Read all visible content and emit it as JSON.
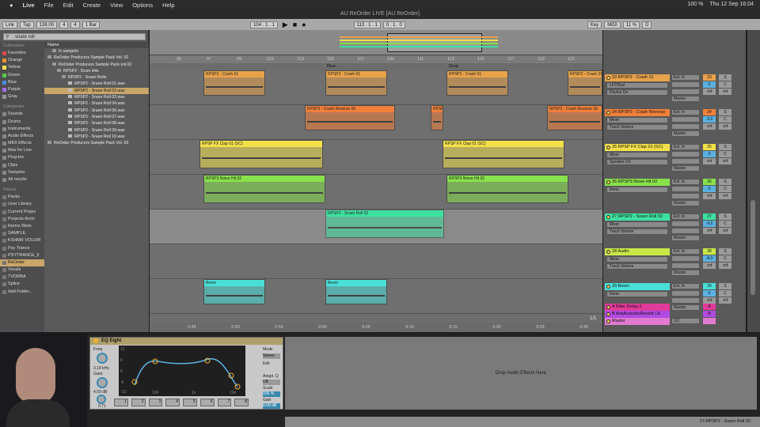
{
  "menubar": {
    "apple": "",
    "app": "Live",
    "items": [
      "File",
      "Edit",
      "Create",
      "View",
      "Options",
      "Help"
    ],
    "right": [
      "100 %",
      "Thu 12 Sep  16:04"
    ]
  },
  "window": {
    "title": "AU ReOrder LIVE  [AU ReOrder]"
  },
  "transport": {
    "link": "Link",
    "tap": "Tap",
    "tempo": "138.00",
    "sig_num": "4",
    "sig_den": "4",
    "quant": "1 Bar",
    "position": "104 .  1 .  1",
    "loop_start": "113 .  1 .  1",
    "loop_len": "0 .  1 .  0",
    "key": "Key",
    "midi": "MIDI",
    "cpu": "11 %",
    "d": "D"
  },
  "browser": {
    "search_value": "snare roll",
    "collections_header": "Collections",
    "collections": [
      {
        "label": "Favorites",
        "color": "#e24a4a"
      },
      {
        "label": "Orange",
        "color": "#f0903a"
      },
      {
        "label": "Yellow",
        "color": "#f2e04a"
      },
      {
        "label": "Green",
        "color": "#58c94a"
      },
      {
        "label": "Blue",
        "color": "#4a8ef0"
      },
      {
        "label": "Purple",
        "color": "#a46ef0"
      },
      {
        "label": "Gray",
        "color": "#999999"
      }
    ],
    "categories_header": "Categories",
    "categories": [
      "Sounds",
      "Drums",
      "Instruments",
      "Audio Effects",
      "MIDI Effects",
      "Max for Live",
      "Plug-Ins",
      "Clips",
      "Samples",
      "All results"
    ],
    "places_header": "Places",
    "places": [
      "Packs",
      "User Library",
      "Current Projec",
      "Projects Archi",
      "Remix Work",
      "SAMPLE",
      "KSHMR VOLUM",
      "Psy Trance",
      "PSYTRANCE_fi",
      "ReOrder",
      "Vocals",
      "TVORBA",
      "Splice",
      "Add Folder..."
    ],
    "files_header": "Name",
    "files": [
      "fx sampels",
      "ReOrder Producers Sample Pack Vol. 02",
      "ReOrder Producers Sample Pack vol.02",
      "RPSP2 - Drum Hits",
      "RPSP2 - Snare Rolls",
      "RPSP2 - Snare Roll 01.wav",
      "RPSP2 - Snare Roll 02.wav",
      "RPSP2 - Snare Roll 03.wav",
      "RPSP2 - Snare Roll 04.wav",
      "RPSP2 - Snare Roll 06.wav",
      "RPSP2 - Snare Roll 07.wav",
      "RPSP2 - Snare Roll 08.wav",
      "RPSP2 - Snare Roll 09.wav",
      "RPSP2 - Snare Roll 10.wav",
      "ReOrder Producers Sample Pack Vol. 03"
    ]
  },
  "ruler": {
    "bars": [
      "95",
      "97",
      "99",
      "101",
      "103",
      "105",
      "107",
      "109",
      "111",
      "113",
      "115",
      "117",
      "119",
      "121"
    ],
    "times": [
      "2:45",
      "2:50",
      "2:55",
      "3:00",
      "3:05",
      "3:10",
      "3:15",
      "3:20",
      "3:25",
      "3:30"
    ],
    "locators": [
      "Rise",
      "Drop"
    ],
    "zoom": "1/1"
  },
  "tracks": [
    {
      "num": "23",
      "name": "23 RPSP2 - Crash 01",
      "color": "#e8a24a",
      "devices": [
        "LFOTool",
        "Device On"
      ],
      "io": [
        "Ext. In",
        "",
        "",
        "Master"
      ],
      "clips": [
        {
          "label": "RPSP2 - Crash 01"
        },
        {
          "label": "RPSP2 - Crash 01"
        },
        {
          "label": "RPSP2 - Crash 01"
        },
        {
          "label": "RPSP2 - Crash 01"
        }
      ]
    },
    {
      "num": "24",
      "name": "24 RPSP2 - Crash Reverse",
      "color": "#f0803a",
      "devices": [
        "Mixer",
        "Track Volume"
      ],
      "io": [
        "Ext. In",
        "",
        "",
        "Master"
      ],
      "vol": "-3.0",
      "clips": [
        {
          "label": "RPSP2 - Crash Reverse 06"
        },
        {
          "label": "RPSP"
        },
        {
          "label": "RPSP2 - Crash Reverse 06"
        }
      ]
    },
    {
      "num": "25",
      "name": "25 RPSP FX Clap 01 (SC)",
      "color": "#f2e04a",
      "devices": [
        "Mixer",
        "Speaker On"
      ],
      "io": [
        "Ext. In",
        "",
        "",
        "Master"
      ],
      "clips": [
        {
          "label": "RPSP FX Clap 01 (SC)"
        },
        {
          "label": "RPSP FX Clap 01 (SC)"
        }
      ]
    },
    {
      "num": "26",
      "name": "26 RPSP3 Noise Hit 02",
      "color": "#88e04a",
      "devices": [
        "None"
      ],
      "io": [
        "Ext. In",
        "",
        "",
        "Master"
      ],
      "clips": [
        {
          "label": "RPSP3 Noise Hit 02"
        },
        {
          "label": "RPSP3 Noise Hit 02"
        }
      ]
    },
    {
      "num": "27",
      "name": "27 RPSP2 - Snare Roll 02",
      "color": "#3ee0a0",
      "devices": [
        "Mixer",
        "Track Volume"
      ],
      "io": [
        "Ext. In",
        "",
        "",
        "Master"
      ],
      "vol": "-9.0",
      "clips": [
        {
          "label": "RPSP2 - Snare Roll 02"
        }
      ]
    },
    {
      "num": "28",
      "name": "28 Audio",
      "color": "#c8e84a",
      "devices": [
        "Mixer",
        "Track Volume"
      ],
      "io": [
        "Ext. In",
        "",
        "",
        "Master"
      ],
      "vol": "-8.0",
      "clips": []
    },
    {
      "num": "29",
      "name": "29 Boom",
      "color": "#4ae0d8",
      "devices": [
        "None"
      ],
      "io": [
        "Ext. In",
        "",
        "",
        "Master"
      ],
      "clips": [
        {
          "label": "Boom"
        },
        {
          "label": "Boom"
        }
      ]
    }
  ],
  "returns": [
    {
      "name": "A Filter Delay-1",
      "num": "A",
      "color": "#e03a9a"
    },
    {
      "name": "B ArtsAcousticReverb | E",
      "num": "B",
      "color": "#b04ae0"
    },
    {
      "name": "Master",
      "num": "",
      "color": "#e07ad0",
      "io": "1/2"
    }
  ],
  "mixer_values": {
    "s": "S",
    "c": "C",
    "inf": "-inf",
    "zero": "0"
  },
  "device": {
    "name": "EQ Eight",
    "freq_label": "Freq",
    "freq": "3.18 kHz",
    "gain_label": "Gain",
    "gain": "4.59 dB",
    "q": "0.71",
    "mode_label": "Mode",
    "mode": "Stereo",
    "edit_label": "Edit",
    "adapt_label": "Adapt. Q",
    "adapt": "Off",
    "scale_label": "Scale",
    "scale": "100 %",
    "gain2_label": "Gain",
    "gain2": "0.00 dB",
    "db": [
      "12",
      "6",
      "0",
      "-6",
      "-12"
    ],
    "hz": [
      "100",
      "1k",
      "10k"
    ],
    "bands": [
      "1",
      "2",
      "3",
      "4",
      "5",
      "6",
      "7",
      "8"
    ]
  },
  "drop_zone": "Drop Audio Effects Here",
  "status": "27-RPSP2 - Snare Roll 02"
}
